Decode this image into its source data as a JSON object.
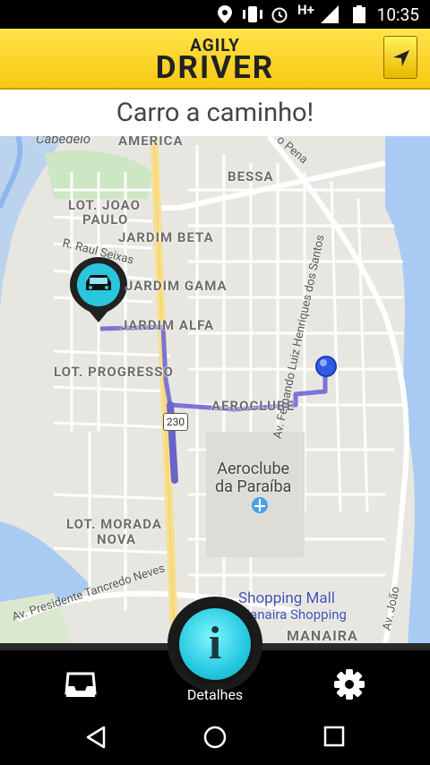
{
  "status_bar": {
    "time": "10:35",
    "network": "H+"
  },
  "header": {
    "logo_top": "AGILY",
    "logo_bottom": "DRIVER"
  },
  "status_message": "Carro a caminho!",
  "map": {
    "labels": {
      "cabedelo": "Cabedelo",
      "america": "AMERICA",
      "bessa": "BESSA",
      "joao_paulo_1": "LOT. JOAO",
      "joao_paulo_2": "PAULO",
      "raul_seixas": "R. Raul Seixas",
      "jardim_beta": "JARDIM BETA",
      "jardim_gama": "JARDIM GAMA",
      "jardim_alfa": "JARDIM ALFA",
      "progresso": "LOT. PROGRESSO",
      "aeroclube": "AEROCLUBE",
      "route_230": "230",
      "aeroclube_poi_1": "Aeroclube",
      "aeroclube_poi_2": "da Paraíba",
      "morada_nova_1": "LOT. MORADA",
      "morada_nova_2": "NOVA",
      "tancredo": "Av. Presidente Tancredo Neves",
      "fernando": "Av. Fernando Luiz Henriques dos Santos",
      "shopping_1": "Shopping Mall",
      "shopping_2": "Manaira Shopping",
      "manaira": "MANAIRA",
      "joao": "Av. João",
      "pena": "o Pena"
    }
  },
  "bottom_bar": {
    "details_label": "Detalhes"
  },
  "colors": {
    "brand_yellow": "#f7c812",
    "accent_cyan": "#25c9e0",
    "route": "#7b74d6",
    "water": "#a9cbf3"
  }
}
